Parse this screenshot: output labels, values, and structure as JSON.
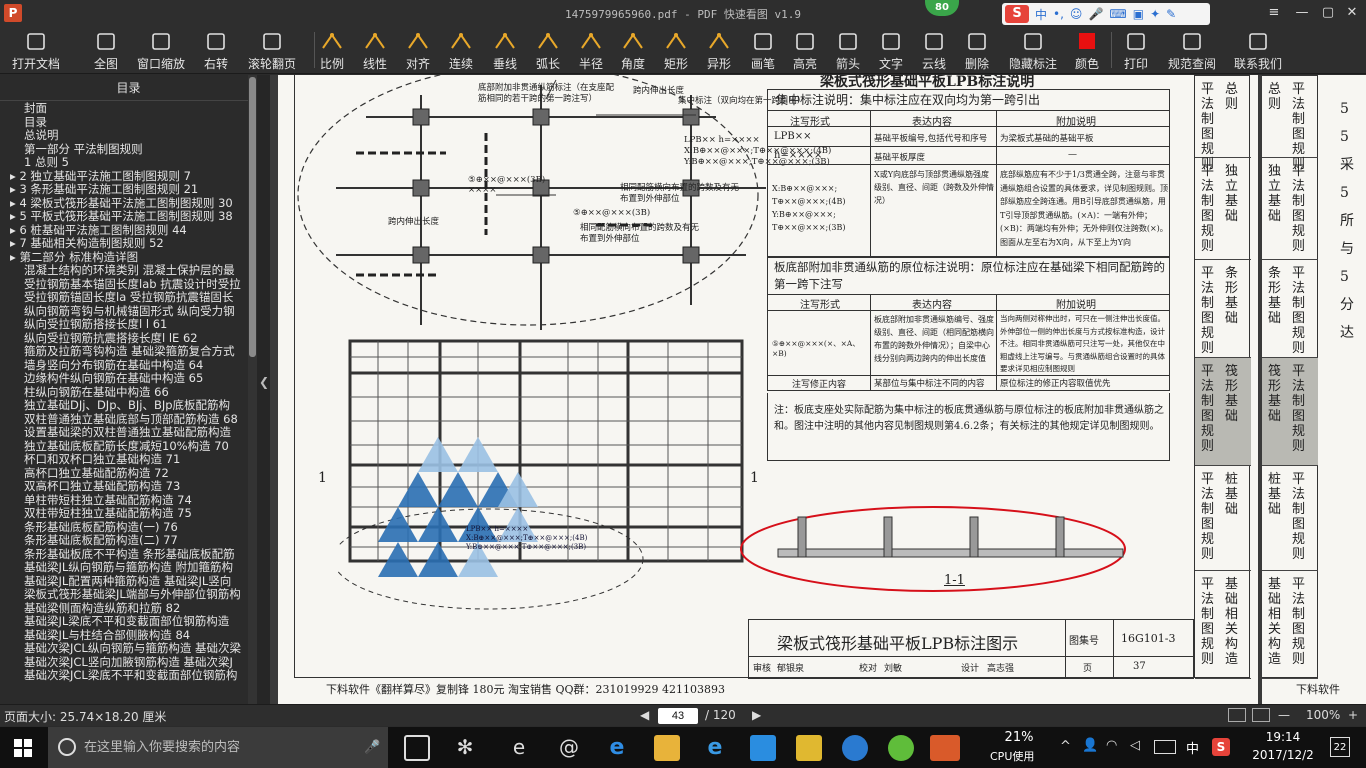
{
  "window": {
    "title": "1475979965960.pdf - PDF 快速看图 v1.9",
    "logo": "P",
    "badge": "80",
    "ime_label": "中"
  },
  "toolbar": {
    "items": [
      {
        "label": "打开文档",
        "icon": "folder-icon"
      },
      {
        "label": "全图",
        "icon": "fit-all-icon"
      },
      {
        "label": "窗口缩放",
        "icon": "zoom-icon"
      },
      {
        "label": "右转",
        "icon": "rotate-icon"
      },
      {
        "label": "滚轮翻页",
        "icon": "mouse-icon"
      },
      {
        "label": "比例",
        "icon": "scale-icon"
      },
      {
        "label": "线性",
        "icon": "linear-icon"
      },
      {
        "label": "对齐",
        "icon": "align-icon"
      },
      {
        "label": "连续",
        "icon": "continuous-icon"
      },
      {
        "label": "垂线",
        "icon": "perpendicular-icon"
      },
      {
        "label": "弧长",
        "icon": "arc-icon"
      },
      {
        "label": "半径",
        "icon": "radius-icon"
      },
      {
        "label": "角度",
        "icon": "angle-icon"
      },
      {
        "label": "矩形",
        "icon": "rectangle-icon"
      },
      {
        "label": "异形",
        "icon": "polygon-icon"
      },
      {
        "label": "画笔",
        "icon": "pen-icon"
      },
      {
        "label": "高亮",
        "icon": "highlighter-icon"
      },
      {
        "label": "箭头",
        "icon": "arrow-icon"
      },
      {
        "label": "文字",
        "icon": "text-icon"
      },
      {
        "label": "云线",
        "icon": "cloud-icon"
      },
      {
        "label": "删除",
        "icon": "eraser-icon"
      },
      {
        "label": "隐藏标注",
        "icon": "eye-hide-icon"
      },
      {
        "label": "颜色",
        "icon": "color-icon"
      },
      {
        "label": "打印",
        "icon": "printer-icon"
      },
      {
        "label": "规范查阅",
        "icon": "book-icon"
      },
      {
        "label": "联系我们",
        "icon": "contact-icon"
      }
    ],
    "color_swatch": "#e81010"
  },
  "sidebar": {
    "header": "目录",
    "items": [
      "封面",
      "目录",
      "总说明",
      "第一部分 平法制图规则",
      "1 总则 5",
      "2 独立基础平法施工图制图规则 7",
      "3 条形基础平法施工图制图规则 21",
      "4 梁板式筏形基础平法施工图制图规则 30",
      "5 平板式筏形基础平法施工图制图规则 38",
      "6 桩基础平法施工图制图规则 44",
      "7 基础相关构造制图规则 52",
      "第二部分 标准构造详图",
      "混凝土结构的环境类别 混凝土保护层的最",
      "受拉钢筋基本锚固长度lab 抗震设计时受拉",
      "受拉钢筋锚固长度la 受拉钢筋抗震锚固长",
      "纵向钢筋弯钩与机械锚固形式 纵向受力钢",
      "纵向受拉钢筋搭接长度l l 61",
      "纵向受拉钢筋抗震搭接长度l lE 62",
      "箍筋及拉筋弯钩构造 基础梁箍筋复合方式",
      "墙身竖向分布钢筋在基础中构造 64",
      "边缘构件纵向钢筋在基础中构造 65",
      "柱纵向钢筋在基础中构造 66",
      "独立基础DJj、DJp、BJj、BJp底板配筋构",
      "双柱普通独立基础底部与顶部配筋构造 68",
      "设置基础梁的双柱普通独立基础配筋构造",
      "独立基础底板配筋长度减短10%构造 70",
      "杯口和双杯口独立基础构造 71",
      "高杯口独立基础配筋构造 72",
      "双高杯口独立基础配筋构造 73",
      "单柱带短柱独立基础配筋构造 74",
      "双柱带短柱独立基础配筋构造 75",
      "条形基础底板配筋构造(一) 76",
      "条形基础底板配筋构造(二) 77",
      "条形基础板底不平构造 条形基础底板配筋",
      "基础梁JL纵向钢筋与箍筋构造 附加箍筋构",
      "基础梁JL配置两种箍筋构造 基础梁JL竖向",
      "梁板式筏形基础梁JL端部与外伸部位钢筋构",
      "基础梁侧面构造纵筋和拉筋 82",
      "基础梁JL梁底不平和变截面部位钢筋构造",
      "基础梁JL与柱结合部侧腋构造 84",
      "基础次梁JCL纵向钢筋与箍筋构造 基础次梁",
      "基础次梁JCL竖向加腋钢筋构造 基础次梁J",
      "基础次梁JCL梁底不平和变截面部位钢筋构"
    ]
  },
  "document": {
    "top_title": "梁板式筏形基础平板LPB标注说明",
    "concentrated_title": "集中标注说明：集中标注应在双向均为第一跨引出",
    "table1_headers": [
      "注写形式",
      "表达内容",
      "附加说明"
    ],
    "table1_rows": [
      [
        "LPB××",
        "基础平板编号,包括代号和序号",
        "为梁板式基础的基础平板"
      ],
      [
        "h=××××",
        "基础平板厚度",
        "—"
      ],
      [
        "X:B⊕××@×××;\nT⊕××@×××;(4B)\nY:B⊕××@×××;\nT⊕××@×××;(3B)",
        "X或Y向底部与顶部贯通纵筋强度级别、直径、间距（跨数及外伸情况）",
        "底部纵筋应有不少于1/3贯通全跨，注意与非贯通纵筋组合设置的具体要求，详见制图规则。顶部纵筋应全跨连通。用B引导底部贯通纵筋，用T引导顶部贯通纵筋。(×A)：一端有外伸；(×B)：两端均有外伸；无外伸则仅注跨数(×)。图面从左至右为X向，从下至上为Y向"
      ]
    ],
    "original_title": "板底部附加非贯通纵筋的原位标注说明：原位标注应在基础梁下相同配筋跨的第一跨下注写",
    "table2_headers": [
      "注写形式",
      "表达内容",
      "附加说明"
    ],
    "table2_rows": [
      [
        "⑤⊕××@×××(×、×A、×B)",
        "板底部附加非贯通纵筋编号、强度级别、直径、间距（相同配筋横向布置的跨数外伸情况）；自梁中心线分别向两边跨内的伸出长度值",
        "当向两侧对称伸出时，可只在一侧注伸出长度值。外伸部位一侧的伸出长度与方式按标准构造，设计不注。相同非贯通纵筋可只注写一处，其他仅在中粗虚线上注写编号。与贯通纵筋组合设置时的具体要求详见相应制图规则"
      ],
      [
        "注写修正内容",
        "某部位与集中标注不同的内容",
        "原位标注的修正内容取值优先"
      ]
    ],
    "note": "注：板底支座处实际配筋为集中标注的板底贯通纵筋与原位标注的板底附加非贯通纵筋之和。图注中注明的其他内容见制图规则第4.6.2条；有关标注的其他规定详见制图规则。",
    "section_label": "1-1",
    "cut_left": "1",
    "cut_right": "1",
    "drawing_title": "梁板式筏形基础平板LPB标注图示",
    "atlas_label": "图集号",
    "atlas_no": "16G101-3",
    "page_label": "页",
    "page_no": "37",
    "sign_row": [
      "审核",
      "郁银泉",
      "校对",
      "刘敏",
      "设计",
      "高志强"
    ],
    "watermark_text": "下料软件《翻样算尽》复制锋 180元 淘宝销售 QQ群：231019929 421103893",
    "annotation_cross": "跨内伸出长度",
    "annotation_concentrated": "集中标注（双向均在第一跨引出）",
    "annotation_support": "底部附加非贯通纵筋标注（在支座配筋相同的若干跨的第一跨注写）",
    "annotation_same": "相同配筋横向布置的跨数及有无布置到外伸部位",
    "code_block": [
      "LPB×× h=××××",
      "X:B⊕××@×××;T⊕××@×××;(4B)",
      "Y:B⊕××@×××;T⊕××@×××;(3B)"
    ],
    "rebar_tag": "⑤⊕××@×××(3B)",
    "dims": "××××",
    "side_tabs": [
      {
        "a": "平法制图规则",
        "b": "总则"
      },
      {
        "a": "平法制图规则",
        "b": "独立基础"
      },
      {
        "a": "平法制图规则",
        "b": "条形基础"
      },
      {
        "a": "平法制图规则",
        "b": "筏形基础"
      },
      {
        "a": "平法制图规则",
        "b": "桩基础"
      },
      {
        "a": "平法制图规则",
        "b": "基础相关构造"
      }
    ],
    "next_page_tabs": [
      {
        "a": "总则",
        "b": "平法制图规则"
      },
      {
        "a": "独立基础",
        "b": "平法制图规则"
      },
      {
        "a": "条形基础",
        "b": "平法制图规则"
      },
      {
        "a": "筏形基础",
        "b": "平法制图规则"
      },
      {
        "a": "桩基础",
        "b": "平法制图规则"
      },
      {
        "a": "基础相关构造",
        "b": "平法制图规则"
      }
    ],
    "next_page_text": [
      "5",
      "5",
      "采",
      "5",
      "所",
      "与",
      "5",
      "分",
      "达"
    ],
    "next_footer": "下料软件"
  },
  "status": {
    "page_size": "页面大小: 25.74×18.20 厘米",
    "current_page": "43",
    "total_pages": "/ 120",
    "zoom": "100%"
  },
  "taskbar": {
    "search_placeholder": "在这里输入你要搜索的内容",
    "cpu_percent": "21%",
    "cpu_label": "CPU使用",
    "time": "19:14",
    "date": "2017/12/2",
    "lang": "中",
    "notifications": "22"
  }
}
